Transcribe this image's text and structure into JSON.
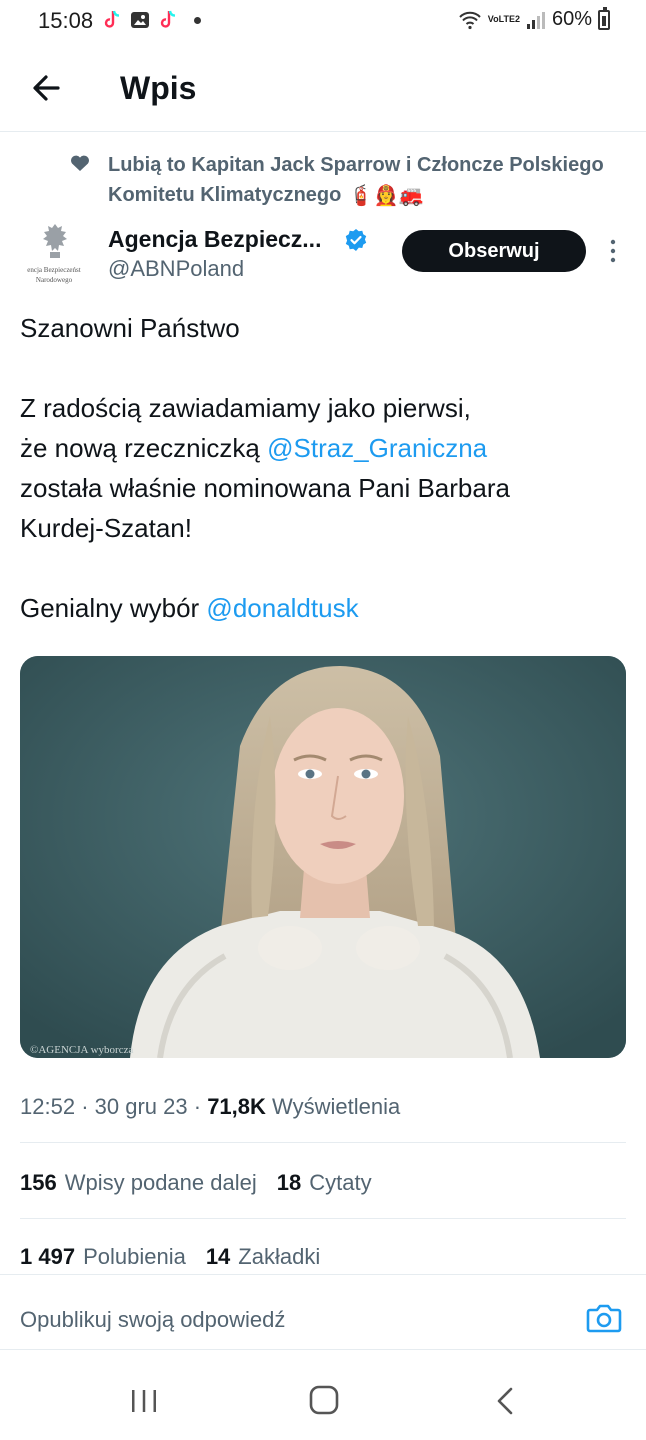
{
  "status_bar": {
    "time": "15:08",
    "battery": "60%",
    "network": "VoLTE2"
  },
  "header": {
    "title": "Wpis"
  },
  "social_context": {
    "text": "Lubią to Kapitan Jack Sparrow i Członcze Polskiego Komitetu Klimatycznego",
    "emoji": "🧯👩‍🚒🚒"
  },
  "author": {
    "name": "Agencja Bezpiecz...",
    "handle": "@ABNPoland",
    "avatar_line1": "encja Bezpieczeńst",
    "avatar_line2": "Narodowego",
    "follow_label": "Obserwuj"
  },
  "tweet": {
    "line1": "Szanowni Państwo",
    "line2": "Z radością zawiadamiamy jako pierwsi,",
    "line3_prefix": "że nową rzeczniczką ",
    "line3_mention": "@Straz_Graniczna",
    "line4": "została właśnie nominowana Pani Barbara",
    "line5": "Kurdej-Szatan!",
    "line6_prefix": "Genialny wybór ",
    "line6_mention": "@donaldtusk"
  },
  "photo": {
    "watermark": "©AGENCJA wyborcza"
  },
  "meta": {
    "time": "12:52",
    "date": "30 gru 23",
    "views_count": "71,8K",
    "views_label": "Wyświetlenia"
  },
  "stats": {
    "retweets_count": "156",
    "retweets_label": "Wpisy podane dalej",
    "quotes_count": "18",
    "quotes_label": "Cytaty",
    "likes_count": "1 497",
    "likes_label": "Polubienia",
    "bookmarks_count": "14",
    "bookmarks_label": "Zakładki"
  },
  "reply": {
    "placeholder": "Opublikuj swoją odpowiedź"
  },
  "colors": {
    "accent": "#1d9bf0",
    "text_primary": "#0f1419",
    "text_secondary": "#536471",
    "follow_bg": "#0f1419"
  }
}
